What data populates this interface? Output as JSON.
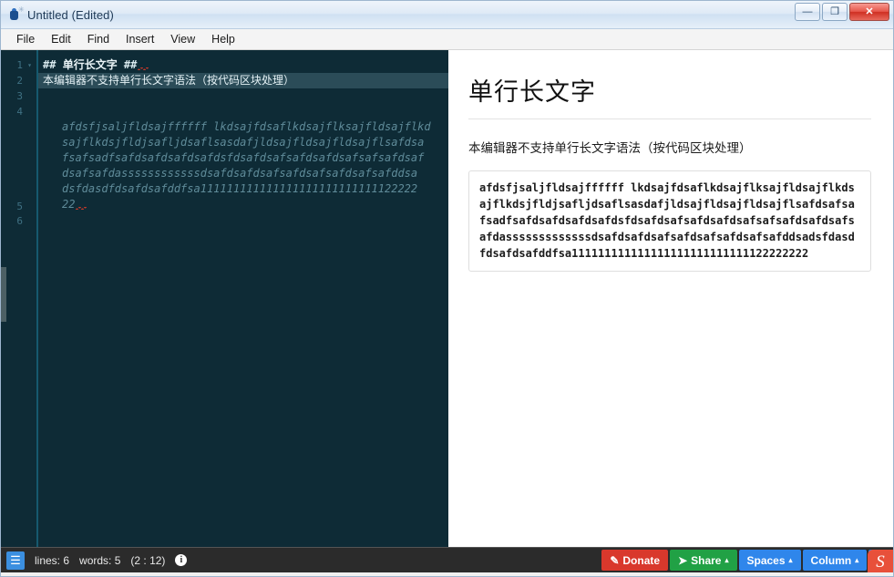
{
  "window": {
    "title": "Untitled (Edited)",
    "icon": "app-icon",
    "buttons": {
      "minimize": "—",
      "maximize": "❐",
      "close": "✕"
    }
  },
  "menubar": {
    "items": [
      {
        "label": "File"
      },
      {
        "label": "Edit"
      },
      {
        "label": "Find"
      },
      {
        "label": "Insert"
      },
      {
        "label": "View"
      },
      {
        "label": "Help"
      }
    ]
  },
  "editor": {
    "gutter": [
      "1",
      "2",
      "3",
      "4",
      "5",
      "6"
    ],
    "fold_marker": "▾",
    "lines": {
      "line1_hash_open": "## ",
      "line1_title": "单行长文字",
      "line1_hash_close": " ##",
      "line2": "本编辑器不支持单行长文字语法（按代码区块处理）"
    },
    "code_block_lines": [
      "afdsfjsaljfldsajffffff lkdsajfdsaflkdsajflksajfldsajflkd",
      "sajflkdsjfldjsafljdsaflsasdafjldsajfldsajfldsajflsafdsa",
      "fsafsadfsafdsafdsafdsafdsfdsafdsafsafdsafdsafsafsafdsaf",
      "dsafsafdassssssssssssdsafdsafdsafsafdsafsafdsafsafddsa",
      "dsfdasdfdsafdsafddfsa111111111111111111111111111122222",
      "22"
    ]
  },
  "preview": {
    "heading": "单行长文字",
    "paragraph": "本编辑器不支持单行长文字语法（按代码区块处理）",
    "code_block": "afdsfjsaljfldsajffffff lkdsajfdsaflkdsajflksajfldsajflkdsajflkdsjfldjsafljdsaflsasdafjldsajfldsajfldsajflsafdsafsafsadfsafdsafdsafdsafdsfdsafdsafsafdsafdsafsafsafdsafdsafsafdasssssssssssssdsafdsafdsafsafdsafsafdsafsafddsadsfdasdfdsafdsafddfsa111111111111111111111111111122222222"
  },
  "statusbar": {
    "doc_icon": "☰",
    "lines_label": "lines: 6",
    "words_label": "words: 5",
    "position": "(2 : 12)",
    "info_icon": "i",
    "buttons": {
      "donate": {
        "label": "Donate",
        "icon": "✎",
        "color": "#d9382c"
      },
      "share": {
        "label": "Share",
        "icon": "➤",
        "caret": "▴",
        "color": "#21a145"
      },
      "spaces": {
        "label": "Spaces",
        "caret": "▴",
        "color": "#2f86eb"
      },
      "column": {
        "label": "Column",
        "caret": "▴",
        "color": "#2f86eb"
      },
      "settings": {
        "icon": "⚙",
        "color": "#2f86eb"
      }
    },
    "corner_logo": "S"
  }
}
